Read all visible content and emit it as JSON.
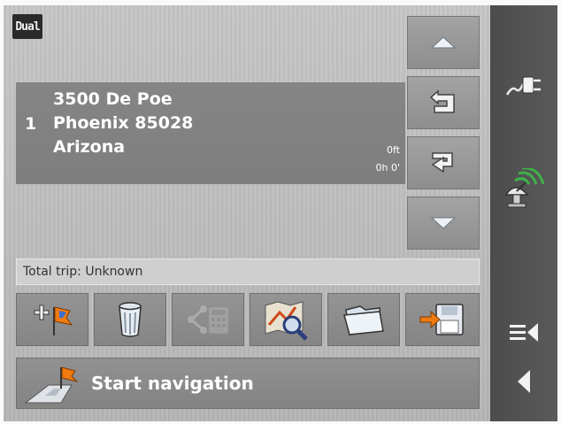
{
  "brand": {
    "logo_text": "Dual"
  },
  "route_entry": {
    "index": "1",
    "address_line1": "3500 De Poe",
    "address_line2": "Phoenix 85028",
    "address_line3": "Arizona",
    "distance": "0ft",
    "time": "0h 0'"
  },
  "total_trip": "Total trip: Unknown",
  "start_navigation_label": "Start navigation",
  "icons": {
    "scroll_up": "triangle-up-icon",
    "move_item_up": "return-left-arrow-icon",
    "move_item_down": "enter-right-arrow-icon",
    "scroll_down": "triangle-down-icon",
    "add_waypoint": "plus-flag-icon",
    "delete": "trash-can-icon",
    "optimize_route": "route-calculator-icon",
    "show_on_map": "map-magnifier-icon",
    "open_route": "folder-icon",
    "save_route": "floppy-save-icon",
    "start_navigation": "flag-road-icon",
    "power": "power-plug-icon",
    "gps_signal": "satellite-icon",
    "menu": "menu-lines-arrow-icon",
    "back": "back-triangle-icon"
  },
  "colors": {
    "panel": "#bdbdbd",
    "address_box": "#828282",
    "sidebar": "#555555",
    "button": "#8f8f8f",
    "flag_orange": "#f07a10"
  }
}
